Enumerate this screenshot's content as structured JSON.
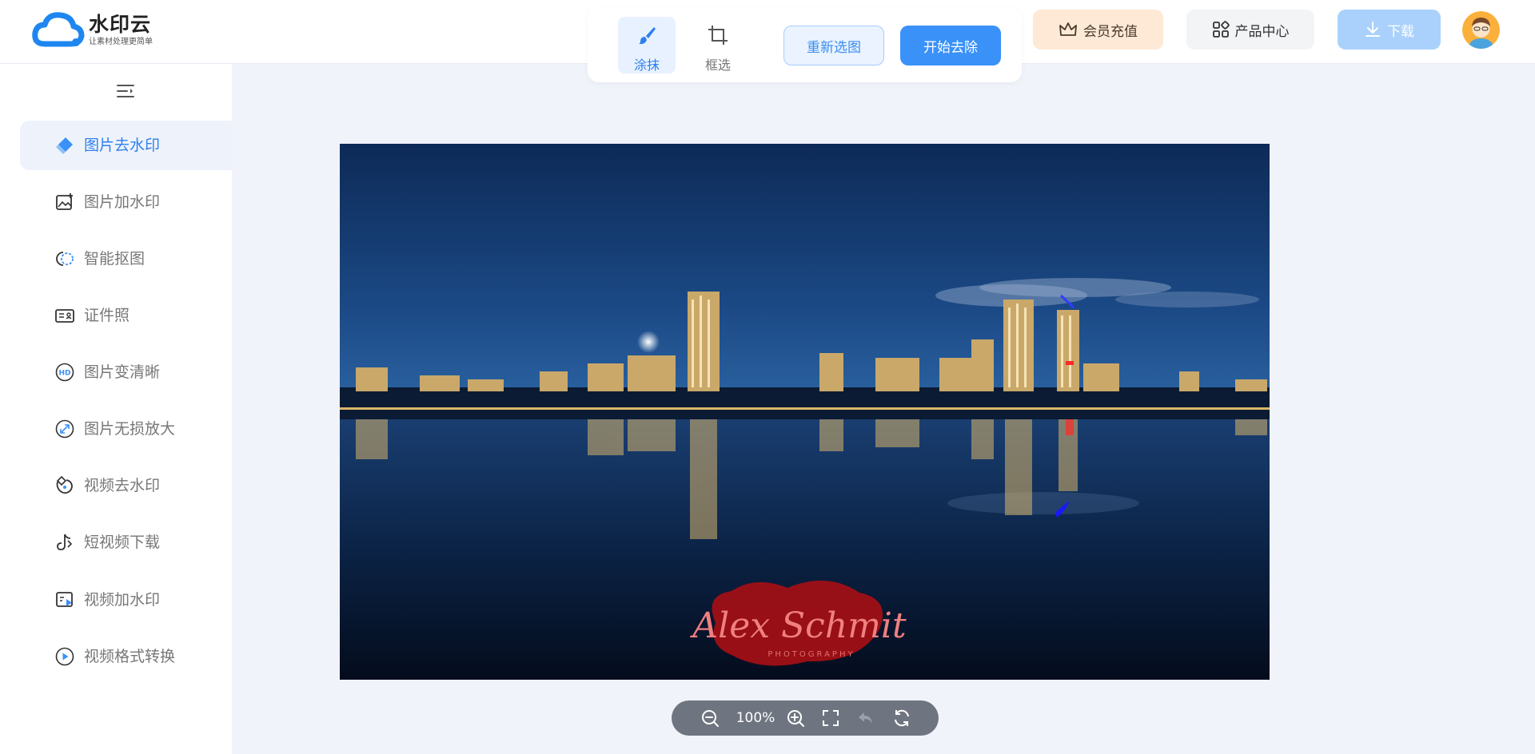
{
  "app": {
    "name": "水印云",
    "slogan": "让素材处理更简单"
  },
  "toolbar": {
    "tools": [
      {
        "label": "涂抹",
        "icon": "brush-icon",
        "active": true
      },
      {
        "label": "框选",
        "icon": "crop-icon",
        "active": false
      }
    ],
    "reselect_label": "重新选图",
    "start_label": "开始去除"
  },
  "header": {
    "vip_label": "会员充值",
    "products_label": "产品中心",
    "download_label": "下载"
  },
  "sidebar": {
    "items": [
      {
        "label": "图片去水印",
        "icon": "eraser-icon",
        "active": true
      },
      {
        "label": "图片加水印",
        "icon": "image-add-icon",
        "active": false
      },
      {
        "label": "智能抠图",
        "icon": "cutout-icon",
        "active": false
      },
      {
        "label": "证件照",
        "icon": "id-card-icon",
        "active": false
      },
      {
        "label": "图片变清晰",
        "icon": "hd-icon",
        "active": false
      },
      {
        "label": "图片无损放大",
        "icon": "enlarge-icon",
        "active": false
      },
      {
        "label": "视频去水印",
        "icon": "video-eraser-icon",
        "active": false
      },
      {
        "label": "短视频下载",
        "icon": "douyin-icon",
        "active": false
      },
      {
        "label": "视频加水印",
        "icon": "video-watermark-icon",
        "active": false
      },
      {
        "label": "视频格式转换",
        "icon": "play-circle-icon",
        "active": false
      }
    ]
  },
  "image": {
    "watermark_text": "Alex Schmit",
    "watermark_sub": "PHOTOGRAPHY"
  },
  "zoom": {
    "level": "100%"
  },
  "colors": {
    "accent": "#3a91f8",
    "active_text": "#2f80ed",
    "vip_bg": "#fde9d6",
    "download_bg": "#a9d1fb"
  }
}
